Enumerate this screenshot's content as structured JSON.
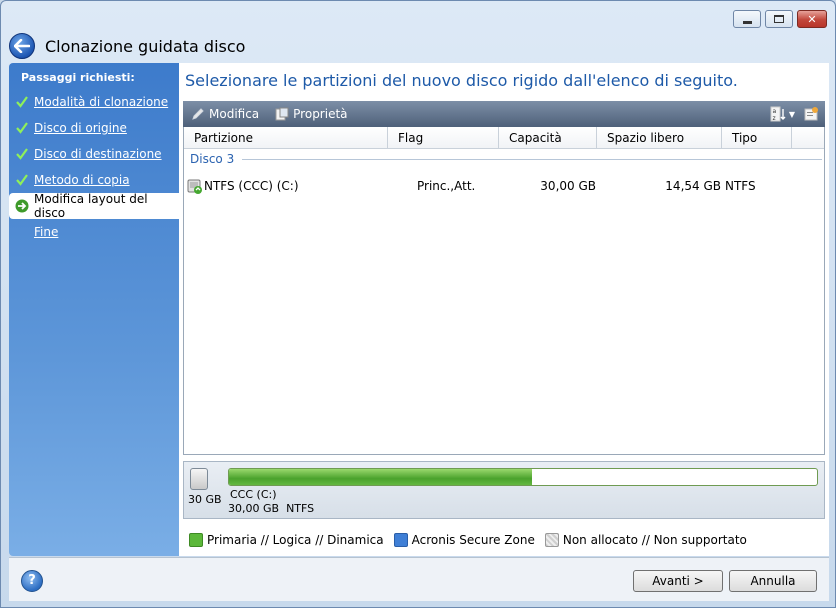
{
  "window": {
    "title": "Clonazione guidata disco"
  },
  "sidebar": {
    "heading": "Passaggi richiesti:",
    "steps": [
      {
        "label": "Modalità di clonazione",
        "state": "done"
      },
      {
        "label": "Disco di origine",
        "state": "done"
      },
      {
        "label": "Disco di destinazione",
        "state": "done"
      },
      {
        "label": "Metodo di copia",
        "state": "done"
      },
      {
        "label": "Modifica layout del disco",
        "state": "current"
      },
      {
        "label": "Fine",
        "state": "pending"
      }
    ]
  },
  "main": {
    "instruction": "Selezionare le partizioni del nuovo disco rigido dall'elenco di seguito.",
    "toolbar": {
      "modify_label": "Modifica",
      "properties_label": "Proprietà"
    },
    "columns": [
      "Partizione",
      "Flag",
      "Capacità",
      "Spazio libero",
      "Tipo"
    ],
    "group_label": "Disco 3",
    "partitions": [
      {
        "name": "NTFS (CCC) (C:)",
        "flag": "Princ.,Att.",
        "capacity": "30,00 GB",
        "free": "14,54 GB",
        "type": "NTFS"
      }
    ]
  },
  "disk_bar": {
    "disk_size": "30 GB",
    "partition_label": "CCC (C:)",
    "partition_size": "30,00 GB",
    "partition_fs": "NTFS",
    "used_fraction": 0.5153
  },
  "legend": [
    {
      "label": "Primaria // Logica // Dinamica",
      "color": "#5cb83a"
    },
    {
      "label": "Acronis Secure Zone",
      "color": "#3f7fd6"
    },
    {
      "label": "Non allocato // Non supportato",
      "color": "#d4d4d4"
    }
  ],
  "footer": {
    "next_label": "Avanti >",
    "cancel_label": "Annulla",
    "help_symbol": "?"
  },
  "colors": {
    "accent": "#1e5aa8",
    "sidebar": "#4a87d2"
  }
}
